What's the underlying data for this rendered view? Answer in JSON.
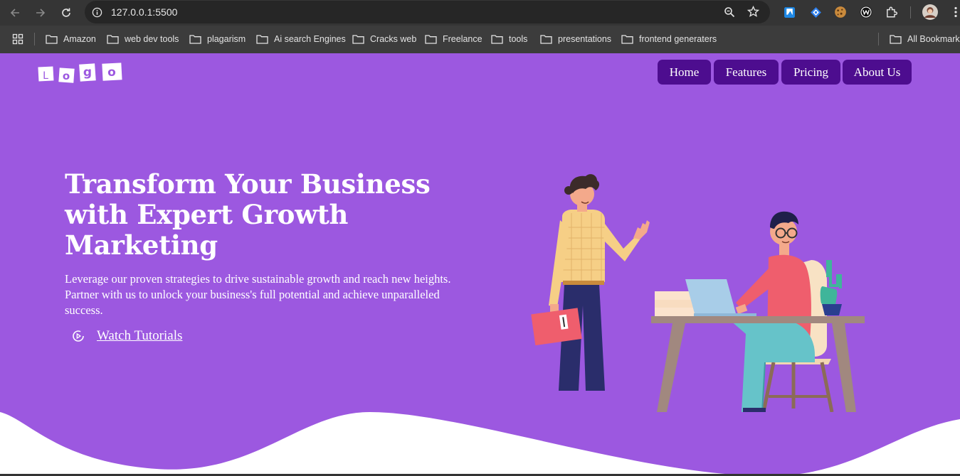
{
  "browser": {
    "url": "127.0.0.1:5500",
    "bookmarks": [
      {
        "label": "Amazon"
      },
      {
        "label": "web dev tools"
      },
      {
        "label": "plagarism"
      },
      {
        "label": "Ai search Engines"
      },
      {
        "label": "Cracks web"
      },
      {
        "label": "Freelance"
      },
      {
        "label": "tools"
      },
      {
        "label": "presentations"
      },
      {
        "label": "frontend generaters"
      }
    ],
    "all_bookmarks": "All Bookmarks"
  },
  "site": {
    "logo_letters": [
      "L",
      "o",
      "g",
      "o"
    ],
    "nav": [
      {
        "label": "Home"
      },
      {
        "label": "Features"
      },
      {
        "label": "Pricing"
      },
      {
        "label": "About Us"
      }
    ],
    "hero": {
      "title": "Transform Your Business with Expert Growth Marketing",
      "text": "Leverage our proven strategies to drive sustainable growth and reach new heights. Partner with us to unlock your business's full potential and achieve unparalleled success.",
      "cta": "Watch Tutorials"
    },
    "colors": {
      "background": "#9c58e0",
      "nav_button": "#4d0d8f",
      "text": "#ffffff"
    }
  }
}
